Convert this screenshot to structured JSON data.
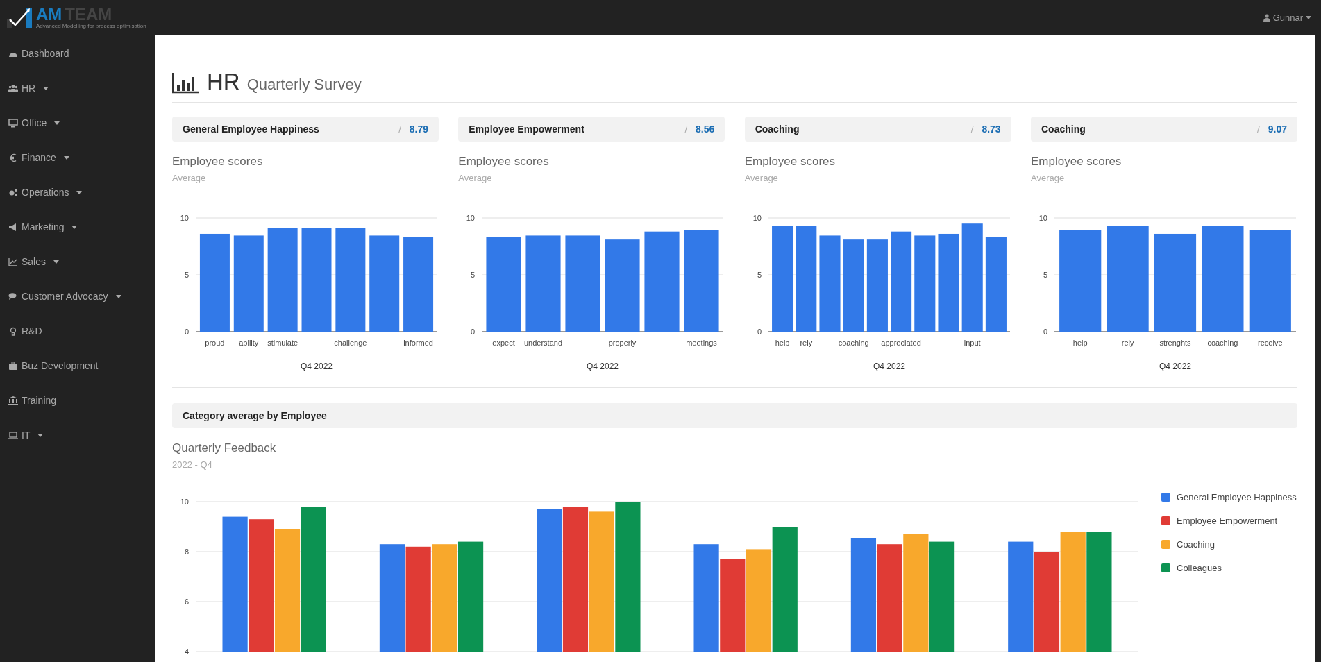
{
  "brand": {
    "name_1": "AM",
    "name_2": "TEAM",
    "tagline": "Advanced Modelling for process optimisation"
  },
  "user_menu": {
    "name": "Gunnar"
  },
  "sidebar": {
    "items": [
      {
        "label": "Dashboard",
        "expandable": false
      },
      {
        "label": "HR",
        "expandable": true
      },
      {
        "label": "Office",
        "expandable": true
      },
      {
        "label": "Finance",
        "expandable": true
      },
      {
        "label": "Operations",
        "expandable": true
      },
      {
        "label": "Marketing",
        "expandable": true
      },
      {
        "label": "Sales",
        "expandable": true
      },
      {
        "label": "Customer Advocacy",
        "expandable": true
      },
      {
        "label": "R&D",
        "expandable": false
      },
      {
        "label": "Buz Development",
        "expandable": false
      },
      {
        "label": "Training",
        "expandable": false
      },
      {
        "label": "IT",
        "expandable": true
      }
    ]
  },
  "page": {
    "title": "HR",
    "subtitle": "Quarterly Survey"
  },
  "score_cards": [
    {
      "title": "General Employee Happiness",
      "separator": "/",
      "score": "8.79",
      "chart_title": "Employee scores",
      "chart_subtitle": "Average",
      "chart_data": {
        "type": "bar",
        "xlabel": "Q4 2022",
        "categories": [
          "proud",
          "ability",
          "stimulate",
          null,
          "challenge",
          null,
          "informed"
        ],
        "values": [
          8.6,
          8.45,
          9.1,
          9.1,
          9.1,
          8.45,
          8.3
        ],
        "ylim": [
          0,
          10
        ],
        "yticks": [
          0,
          5,
          10
        ]
      }
    },
    {
      "title": "Employee Empowerment",
      "separator": "/",
      "score": "8.56",
      "chart_title": "Employee scores",
      "chart_subtitle": "Average",
      "chart_data": {
        "type": "bar",
        "xlabel": "Q4 2022",
        "categories": [
          "expect",
          "understand",
          null,
          "properly",
          null,
          "meetings"
        ],
        "values": [
          8.3,
          8.45,
          8.45,
          8.1,
          8.8,
          8.95
        ],
        "ylim": [
          0,
          10
        ],
        "yticks": [
          0,
          5,
          10
        ]
      }
    },
    {
      "title": "Coaching",
      "separator": "/",
      "score": "8.73",
      "chart_title": "Employee scores",
      "chart_subtitle": "Average",
      "chart_data": {
        "type": "bar",
        "xlabel": "Q4 2022",
        "categories": [
          "help",
          "rely",
          null,
          "coaching",
          null,
          "appreciated",
          null,
          null,
          "input",
          null
        ],
        "values": [
          9.3,
          9.3,
          8.45,
          8.1,
          8.1,
          8.8,
          8.45,
          8.6,
          9.5,
          8.3
        ],
        "ylim": [
          0,
          10
        ],
        "yticks": [
          0,
          5,
          10
        ]
      }
    },
    {
      "title": "Coaching",
      "separator": "/",
      "score": "9.07",
      "chart_title": "Employee scores",
      "chart_subtitle": "Average",
      "chart_data": {
        "type": "bar",
        "xlabel": "Q4 2022",
        "categories": [
          "help",
          "rely",
          "strenghts",
          "coaching",
          "receive"
        ],
        "values": [
          8.95,
          9.3,
          8.6,
          9.3,
          8.95
        ],
        "ylim": [
          0,
          10
        ],
        "yticks": [
          0,
          5,
          10
        ]
      }
    }
  ],
  "category_section": {
    "title": "Category average by Employee",
    "chart_title": "Quarterly Feedback",
    "chart_subtitle": "2022 - Q4",
    "chart_data": {
      "type": "bar",
      "ylim": [
        4,
        10
      ],
      "yticks": [
        4,
        6,
        8,
        10
      ],
      "grid": true,
      "legend": true,
      "series": [
        {
          "name": "General Employee Happiness",
          "color": "#3279e8",
          "values": [
            9.4,
            8.3,
            9.7,
            8.3,
            8.55,
            8.4
          ]
        },
        {
          "name": "Employee Empowerment",
          "color": "#e03b35",
          "values": [
            9.3,
            8.2,
            9.8,
            7.7,
            8.3,
            8.0
          ]
        },
        {
          "name": "Coaching",
          "color": "#f8a82c",
          "values": [
            8.9,
            8.3,
            9.6,
            8.1,
            8.7,
            8.8
          ]
        },
        {
          "name": "Colleagues",
          "color": "#0c9352",
          "values": [
            9.8,
            8.4,
            10.0,
            9.0,
            8.4,
            8.8
          ]
        }
      ]
    }
  }
}
